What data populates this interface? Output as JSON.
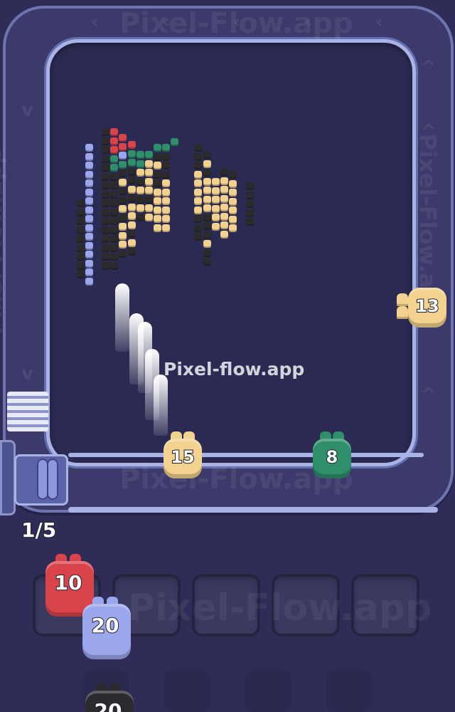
{
  "watermark": {
    "center": "Pixel-flow.app",
    "track_top": "Pixel-Flow.app",
    "track_bottom": "Pixel-Flow.app",
    "track_left": "Pixel-Flow.app",
    "track_right": "Pixel-Flow.app",
    "slots": "Pixel-Flow.app"
  },
  "queue_counter": "1/5",
  "active_shooters": [
    {
      "id": "yellow-15",
      "count": "15",
      "color": "#f2d28e"
    },
    {
      "id": "green-8",
      "count": "8",
      "color": "#2f8f6a"
    },
    {
      "id": "yellow-13",
      "count": "13",
      "color": "#f2d28e"
    }
  ],
  "queue_shooters": [
    {
      "id": "red-10",
      "count": "10",
      "color": "#d9444b"
    },
    {
      "id": "blue-20",
      "count": "20",
      "color": "#9aa7ec"
    },
    {
      "id": "black-20",
      "count": "20",
      "color": "#2a2a2f"
    }
  ],
  "slot_count": 5,
  "colors": {
    "background": "#2f2d57",
    "track": "#3b3a6b",
    "track_rail": "#aab3e6",
    "board": "#2b2a52",
    "pixel_black": "#2b2b2b",
    "pixel_red": "#d9444b",
    "pixel_green": "#2f8f6a",
    "pixel_yellow": "#f2d28e",
    "pixel_blue": "#9aa7ec"
  }
}
